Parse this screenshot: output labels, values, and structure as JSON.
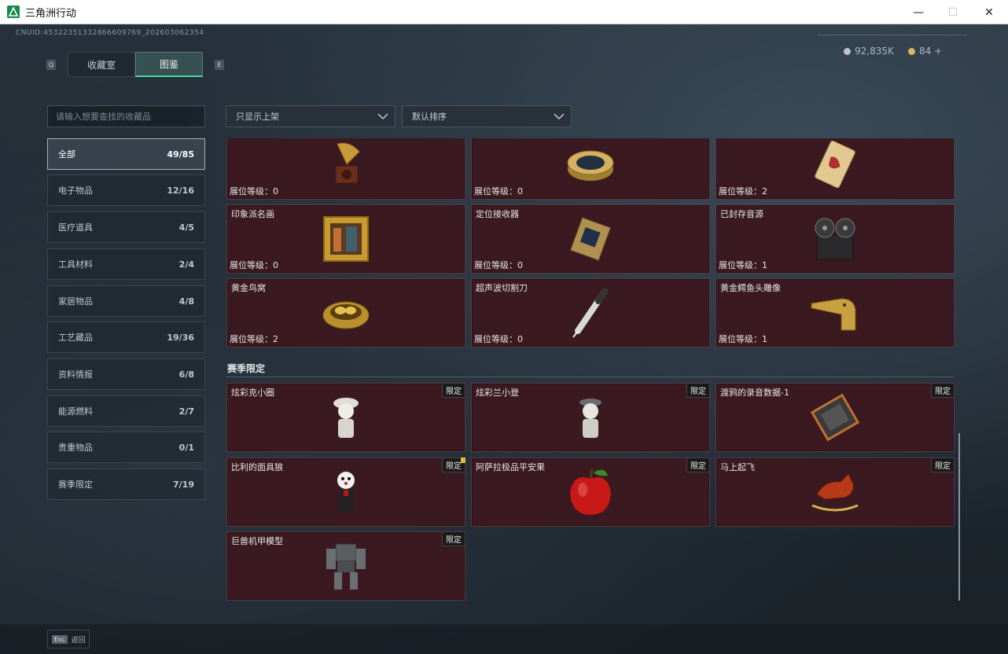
{
  "window": {
    "title": "三角洲行动",
    "minimize": "—",
    "maximize": "☐",
    "close": "✕"
  },
  "header": {
    "uid": "CNUID:453223513328666097​69_202603062354",
    "currency1": "92,835K",
    "currency2": "84 +",
    "hint_left": "Q",
    "hint_right": "E"
  },
  "tabs": [
    {
      "label": "收藏室"
    },
    {
      "label": "图鉴"
    }
  ],
  "search": {
    "placeholder": "请输入想要查找的收藏品"
  },
  "filters": {
    "shelf": "只显示上架",
    "sort": "默认排序"
  },
  "categories": [
    {
      "label": "全部",
      "count": "49/85"
    },
    {
      "label": "电子物品",
      "count": "12/16"
    },
    {
      "label": "医疗道具",
      "count": "4/5"
    },
    {
      "label": "工具材料",
      "count": "2/4"
    },
    {
      "label": "家居物品",
      "count": "4/8"
    },
    {
      "label": "工艺藏品",
      "count": "19/36"
    },
    {
      "label": "资料情报",
      "count": "6/8"
    },
    {
      "label": "能源燃料",
      "count": "2/7"
    },
    {
      "label": "贵重物品",
      "count": "0/1"
    },
    {
      "label": "赛季限定",
      "count": "7/19"
    }
  ],
  "items": [
    {
      "name": "",
      "level": "展位等级：0",
      "icon": "gramophone-icon"
    },
    {
      "name": "",
      "level": "展位等级：0",
      "icon": "caviar-tin-icon"
    },
    {
      "name": "",
      "level": "展位等级：2",
      "icon": "gold-card-icon"
    },
    {
      "name": "印象派名画",
      "level": "展位等级：0",
      "icon": "painting-icon"
    },
    {
      "name": "定位接收器",
      "level": "展位等级：0",
      "icon": "locator-receiver-icon"
    },
    {
      "name": "已封存音源",
      "level": "展位等级：1",
      "icon": "reel-recorder-icon"
    },
    {
      "name": "黄金鸟窝",
      "level": "展位等级：2",
      "icon": "golden-nest-icon"
    },
    {
      "name": "超声波切割刀",
      "level": "展位等级：0",
      "icon": "ultrasonic-cutter-icon"
    },
    {
      "name": "黄金鳄鱼头雕像",
      "level": "展位等级：1",
      "icon": "croc-statue-icon"
    }
  ],
  "season": {
    "title": "赛季限定",
    "badge": "限定",
    "items": [
      {
        "name": "炫彩克小圈",
        "icon": "figurine-icon"
      },
      {
        "name": "炫彩兰小登",
        "icon": "figurine-hat-icon"
      },
      {
        "name": "渡鸦的录音数据-1",
        "icon": "data-drive-icon"
      },
      {
        "name": "比利的面具狼",
        "icon": "puppet-icon",
        "new": true
      },
      {
        "name": "阿萨拉极品平安果",
        "icon": "apple-icon"
      },
      {
        "name": "马上起飞",
        "icon": "rocking-horse-icon"
      },
      {
        "name": "巨兽机甲模型",
        "icon": "mech-model-icon"
      }
    ]
  },
  "footer": {
    "esc_key": "Esc",
    "esc_label": "返回"
  },
  "colors": {
    "accent": "#40d9a0",
    "card_bg": "#3a1a20",
    "card_border": "#5a3a40"
  }
}
